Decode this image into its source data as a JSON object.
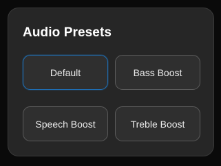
{
  "panel": {
    "title": "Audio Presets"
  },
  "presets": [
    {
      "label": "Default",
      "selected": true
    },
    {
      "label": "Bass Boost",
      "selected": false
    },
    {
      "label": "Speech Boost",
      "selected": false
    },
    {
      "label": "Treble Boost",
      "selected": false
    }
  ],
  "colors": {
    "background": "#0a0a0a",
    "panel": "#262626",
    "button": "#2f2f2f",
    "button_border": "#5b5b5b",
    "selected_border": "#1f6fb5",
    "text": "#ffffff"
  }
}
